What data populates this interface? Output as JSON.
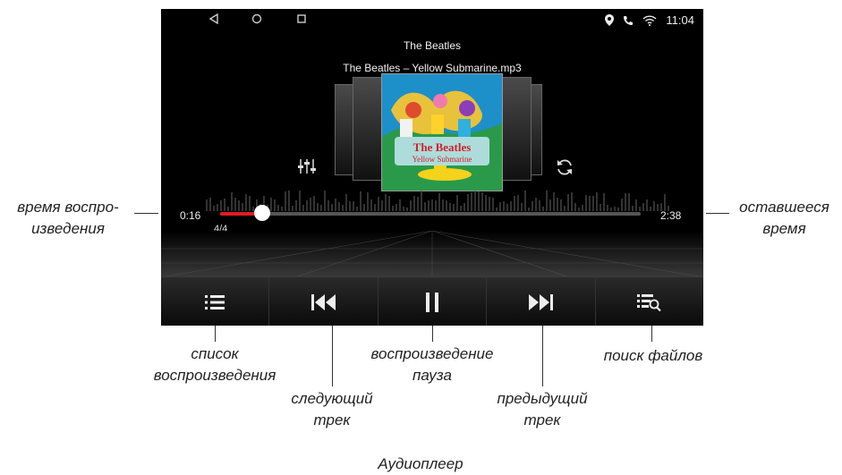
{
  "status_bar": {
    "nav": [
      "back-icon",
      "home-icon",
      "recents-icon"
    ],
    "icons": [
      "location-icon",
      "phone-icon",
      "wifi-icon"
    ],
    "time": "11:04"
  },
  "player": {
    "artist": "The Beatles",
    "track_file": "The Beatles – Yellow Submarine.mp3",
    "album_cover_text": "The Beatles Yellow Submarine",
    "time_elapsed": "0:16",
    "time_remaining": "2:38",
    "track_count": "4/4",
    "progress_fraction": 0.1,
    "accent_color": "#e01b23"
  },
  "controls": [
    {
      "icon": "playlist-icon"
    },
    {
      "icon": "skip-back-icon"
    },
    {
      "icon": "pause-icon"
    },
    {
      "icon": "skip-forward-icon"
    },
    {
      "icon": "file-search-icon"
    }
  ],
  "annotations": {
    "elapsed_line1": "время воспро-",
    "elapsed_line2": "изведения",
    "remaining_line1": "оставшееся",
    "remaining_line2": "время",
    "playlist_line1": "список",
    "playlist_line2": "воспроизведения",
    "next_line1": "следующий",
    "next_line2": "трек",
    "playpause_line1": "воспроизведение",
    "playpause_line2": "пауза",
    "prev_line1": "предыдущий",
    "prev_line2": "трек",
    "search": "поиск файлов",
    "caption": "Аудиоплеер"
  }
}
